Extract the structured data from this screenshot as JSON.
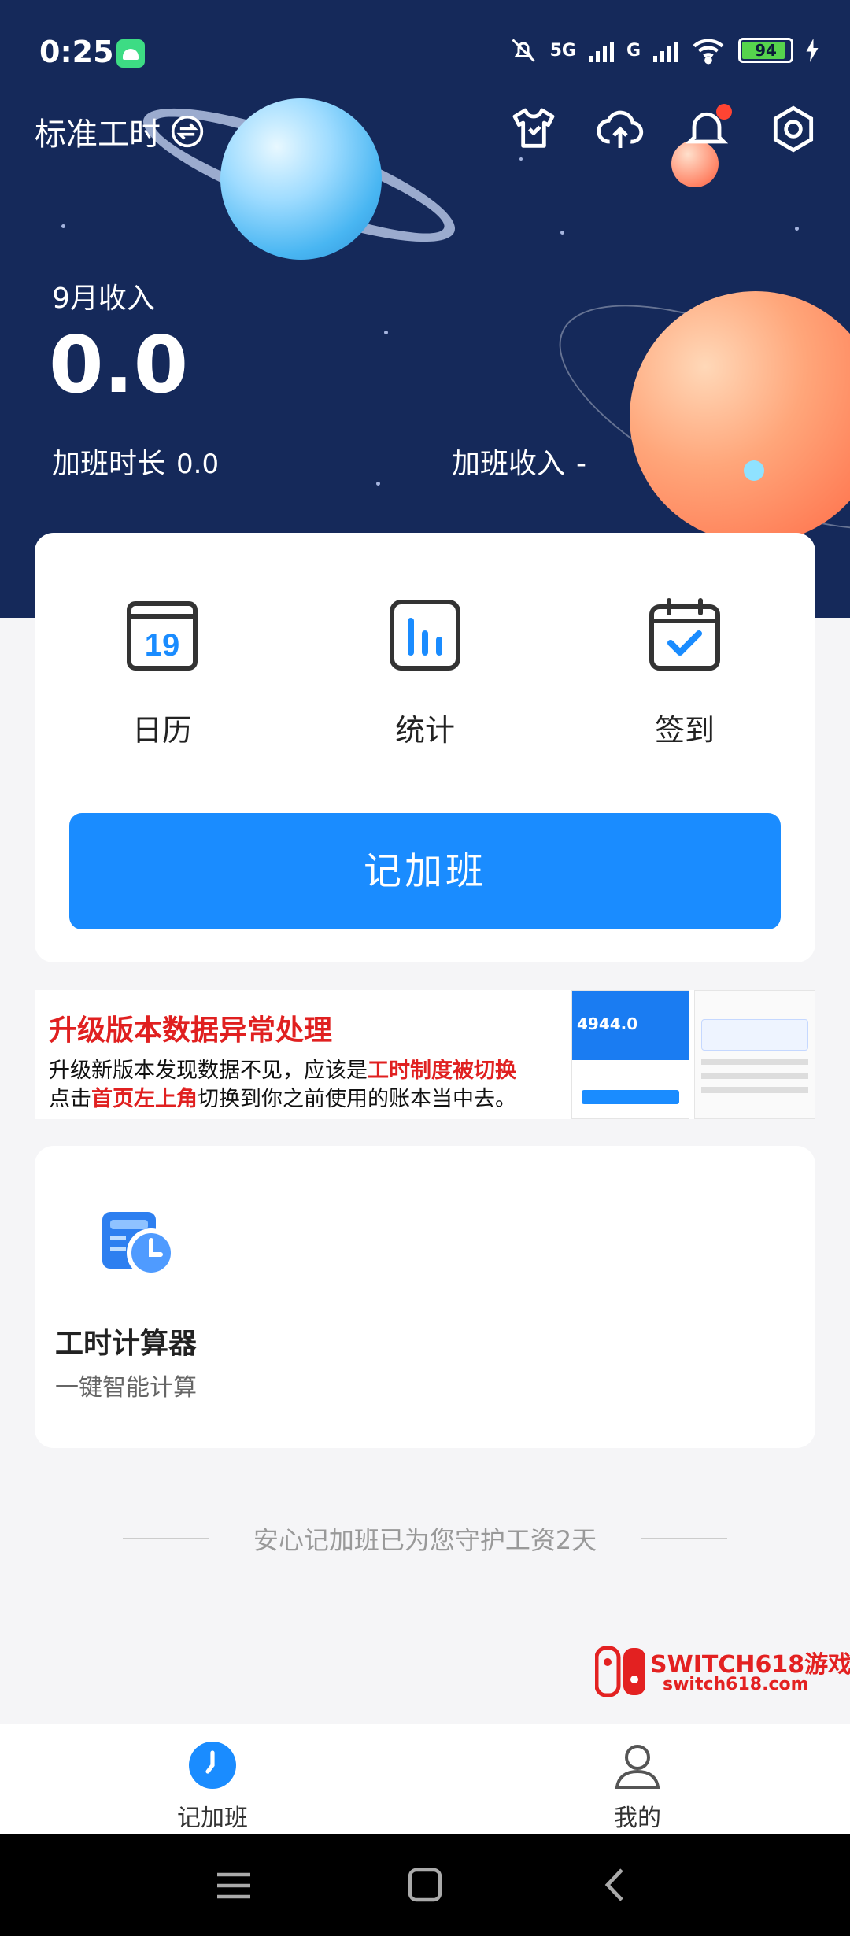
{
  "status_bar": {
    "time": "0:25",
    "network1": "5G",
    "network2": "G",
    "battery": "94"
  },
  "header": {
    "mode_label": "标准工时",
    "income_label": "9月收入",
    "income_value": "0.0",
    "ot_hours_label": "加班时长",
    "ot_hours_value": "0.0",
    "ot_income_label": "加班收入",
    "ot_income_value": "-"
  },
  "top_icons": [
    "shirt-icon",
    "upload-cloud-icon",
    "bell-icon",
    "settings-icon"
  ],
  "quick_actions": [
    {
      "label": "日历",
      "icon": "calendar-icon",
      "day": "19"
    },
    {
      "label": "统计",
      "icon": "stats-icon"
    },
    {
      "label": "签到",
      "icon": "checkin-icon"
    }
  ],
  "primary_button": "记加班",
  "banner": {
    "title": "升级版本数据异常处理",
    "line1_a": "升级新版本发现数据不见，应该是",
    "line1_b": "工时制度被切换",
    "line2_a": "点击",
    "line2_b": "首页左上角",
    "line2_c": "切换到你之前使用的账本当中去。",
    "mini_value": "4944.0"
  },
  "tool": {
    "title": "工时计算器",
    "subtitle": "一键智能计算"
  },
  "footer_text": "安心记加班已为您守护工资2天",
  "watermark": {
    "title": "SWITCH618游戏",
    "url": "switch618.com"
  },
  "tabs": [
    {
      "label": "记加班",
      "active": true
    },
    {
      "label": "我的",
      "active": false
    }
  ],
  "colors": {
    "header_bg": "#15295a",
    "primary": "#1a8cff",
    "accent_red": "#e02020"
  }
}
